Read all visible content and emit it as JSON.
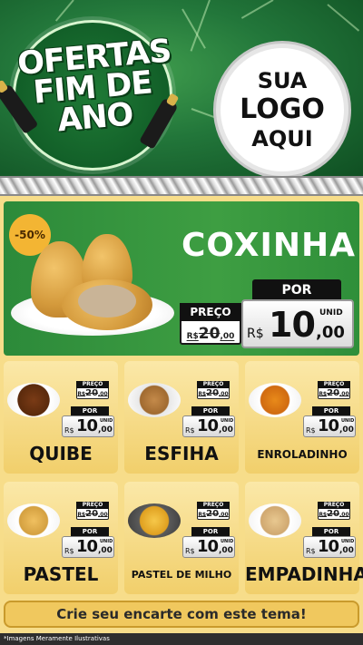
{
  "header": {
    "badge_title": "OFERTAS FIM DE ANO",
    "logo_lines": [
      "SUA",
      "LOGO",
      "AQUI"
    ]
  },
  "featured": {
    "discount": "-50%",
    "name": "COXINHA",
    "preco_label": "PREÇO",
    "old_price_currency": "R$",
    "old_price": "20",
    "old_price_cents": ",00",
    "por_label": "POR",
    "unit_label": "UNID",
    "currency": "R$",
    "price_int": "10",
    "price_dec": ",00"
  },
  "products": [
    {
      "name": "QUIBE",
      "preco_label": "PREÇO",
      "old_currency": "R$",
      "old_price": "20",
      "old_cents": ",00",
      "por_label": "POR",
      "unit_label": "UNID",
      "currency": "R$",
      "price_int": "10",
      "price_dec": ",00"
    },
    {
      "name": "ESFIHA",
      "preco_label": "PREÇO",
      "old_currency": "R$",
      "old_price": "20",
      "old_cents": ",00",
      "por_label": "POR",
      "unit_label": "UNID",
      "currency": "R$",
      "price_int": "10",
      "price_dec": ",00"
    },
    {
      "name": "ENROLADINHO",
      "preco_label": "PREÇO",
      "old_currency": "R$",
      "old_price": "20",
      "old_cents": ",00",
      "por_label": "POR",
      "unit_label": "UNID",
      "currency": "R$",
      "price_int": "10",
      "price_dec": ",00"
    },
    {
      "name": "PASTEL",
      "preco_label": "PREÇO",
      "old_currency": "R$",
      "old_price": "20",
      "old_cents": ",00",
      "por_label": "POR",
      "unit_label": "UNID",
      "currency": "R$",
      "price_int": "10",
      "price_dec": ",00"
    },
    {
      "name": "PASTEL DE MILHO",
      "preco_label": "PREÇO",
      "old_currency": "R$",
      "old_price": "20",
      "old_cents": ",00",
      "por_label": "POR",
      "unit_label": "UNID",
      "currency": "R$",
      "price_int": "10",
      "price_dec": ",00"
    },
    {
      "name": "EMPADINHA",
      "preco_label": "PREÇO",
      "old_currency": "R$",
      "old_price": "20",
      "old_cents": ",00",
      "por_label": "POR",
      "unit_label": "UNID",
      "currency": "R$",
      "price_int": "10",
      "price_dec": ",00"
    }
  ],
  "cta": "Crie seu encarte com este tema!",
  "footer": "*Imagens Meramente Ilustrativas",
  "colors": {
    "header_green": "#22763a",
    "feature_green": "#3e9e42",
    "card_gold": "#f1cf6b",
    "badge_orange": "#f3b533"
  }
}
